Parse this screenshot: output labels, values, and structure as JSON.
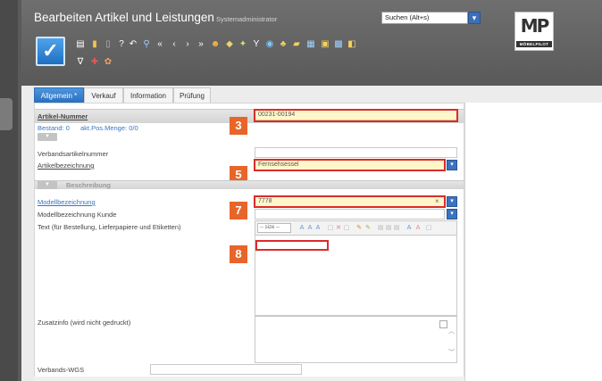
{
  "header": {
    "title": "Bearbeiten Artikel und Leistungen",
    "user": "Systemadministrator",
    "search_placeholder": "Suchen (Alt+s)",
    "logo_mark": "MP",
    "logo_text": "MÖBELPILOT"
  },
  "toolbar": {
    "save_glyph": "✓",
    "icons": [
      "document-icon",
      "bookmark-icon",
      "trash-icon",
      "help-icon",
      "back-icon",
      "search-icon",
      "first-icon",
      "prev-icon",
      "next-icon",
      "last-icon",
      "people-icon",
      "tag-icon",
      "group-icon",
      "filter-icon",
      "globe-icon",
      "users-icon",
      "folder-icon",
      "grid-icon",
      "print-icon",
      "image-icon",
      "export-icon",
      "funnel-icon",
      "flag-icon",
      "settings-icon"
    ]
  },
  "tabs": [
    {
      "label": "Allgemein *",
      "active": true
    },
    {
      "label": "Verkauf",
      "active": false
    },
    {
      "label": "Information",
      "active": false
    },
    {
      "label": "Prüfung",
      "active": false
    }
  ],
  "form": {
    "artikel_nummer_label": "Artikel-Nummer",
    "artikel_nummer_value": "00231-00194",
    "bestand": "Bestand: 0",
    "akt_pos_menge": "akt.Pos.Menge: 0/0",
    "verbandsartikelnummer_label": "Verbandsartikelnummer",
    "artikelbezeichnung_label": "Artikelbezeichnung",
    "artikelbezeichnung_value": "Fernsehsessel",
    "section_beschreibung": "Beschreibung",
    "modellbezeichnung_label": "Modellbezeichnung",
    "modellbezeichnung_value": "7778",
    "modellbezeichnung_kunde_label": "Modellbezeichnung Kunde",
    "text_label": "Text (für Bestellung, Lieferpapiere und Etiketten)",
    "editor_size": "-- size --",
    "zusatzinfo_label": "Zusatzinfo (wird nicht gedruckt)",
    "verbands_wgs_label": "Verbands-WGS"
  },
  "steps": [
    "3",
    "5",
    "7",
    "8"
  ],
  "colors": {
    "accent": "#2a6fbe",
    "highlight": "#d92c2c",
    "step_badge": "#e8652a",
    "field_yellow": "#fff7c9"
  }
}
